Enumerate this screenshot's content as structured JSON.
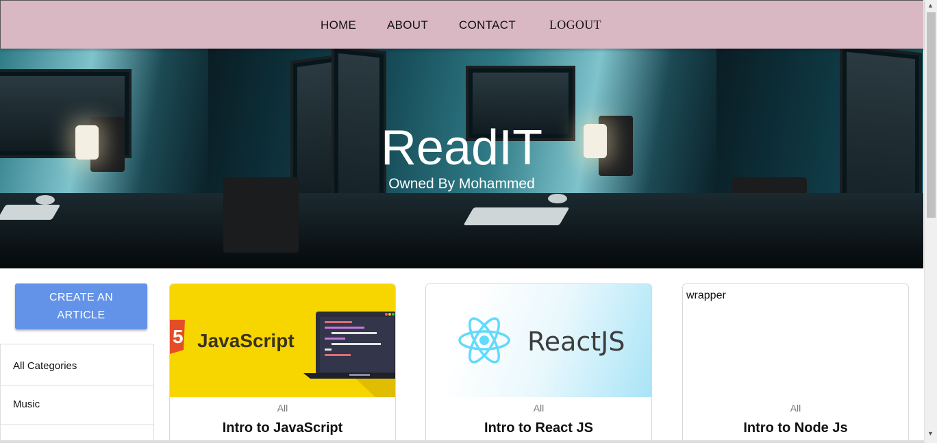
{
  "nav": {
    "items": [
      {
        "label": "HOME"
      },
      {
        "label": "ABOUT"
      },
      {
        "label": "CONTACT"
      },
      {
        "label": "LOGOUT"
      }
    ]
  },
  "hero": {
    "title": "ReadIT",
    "subtitle": "Owned By Mohammed"
  },
  "sidebar": {
    "create_button": "CREATE AN ARTICLE",
    "categories": [
      {
        "label": "All Categories"
      },
      {
        "label": "Music"
      }
    ]
  },
  "cards": [
    {
      "image_text": "JavaScript",
      "category": "All",
      "title": "Intro to JavaScript"
    },
    {
      "image_text": "ReactJS",
      "category": "All",
      "title": "Intro to React JS"
    },
    {
      "image_alt": "wrapper",
      "category": "All",
      "title": "Intro to Node Js"
    }
  ],
  "colors": {
    "nav_bg": "#d9b8c4",
    "button_bg": "#6393e8",
    "js_yellow": "#f7d600",
    "react_blue": "#61dafb"
  }
}
